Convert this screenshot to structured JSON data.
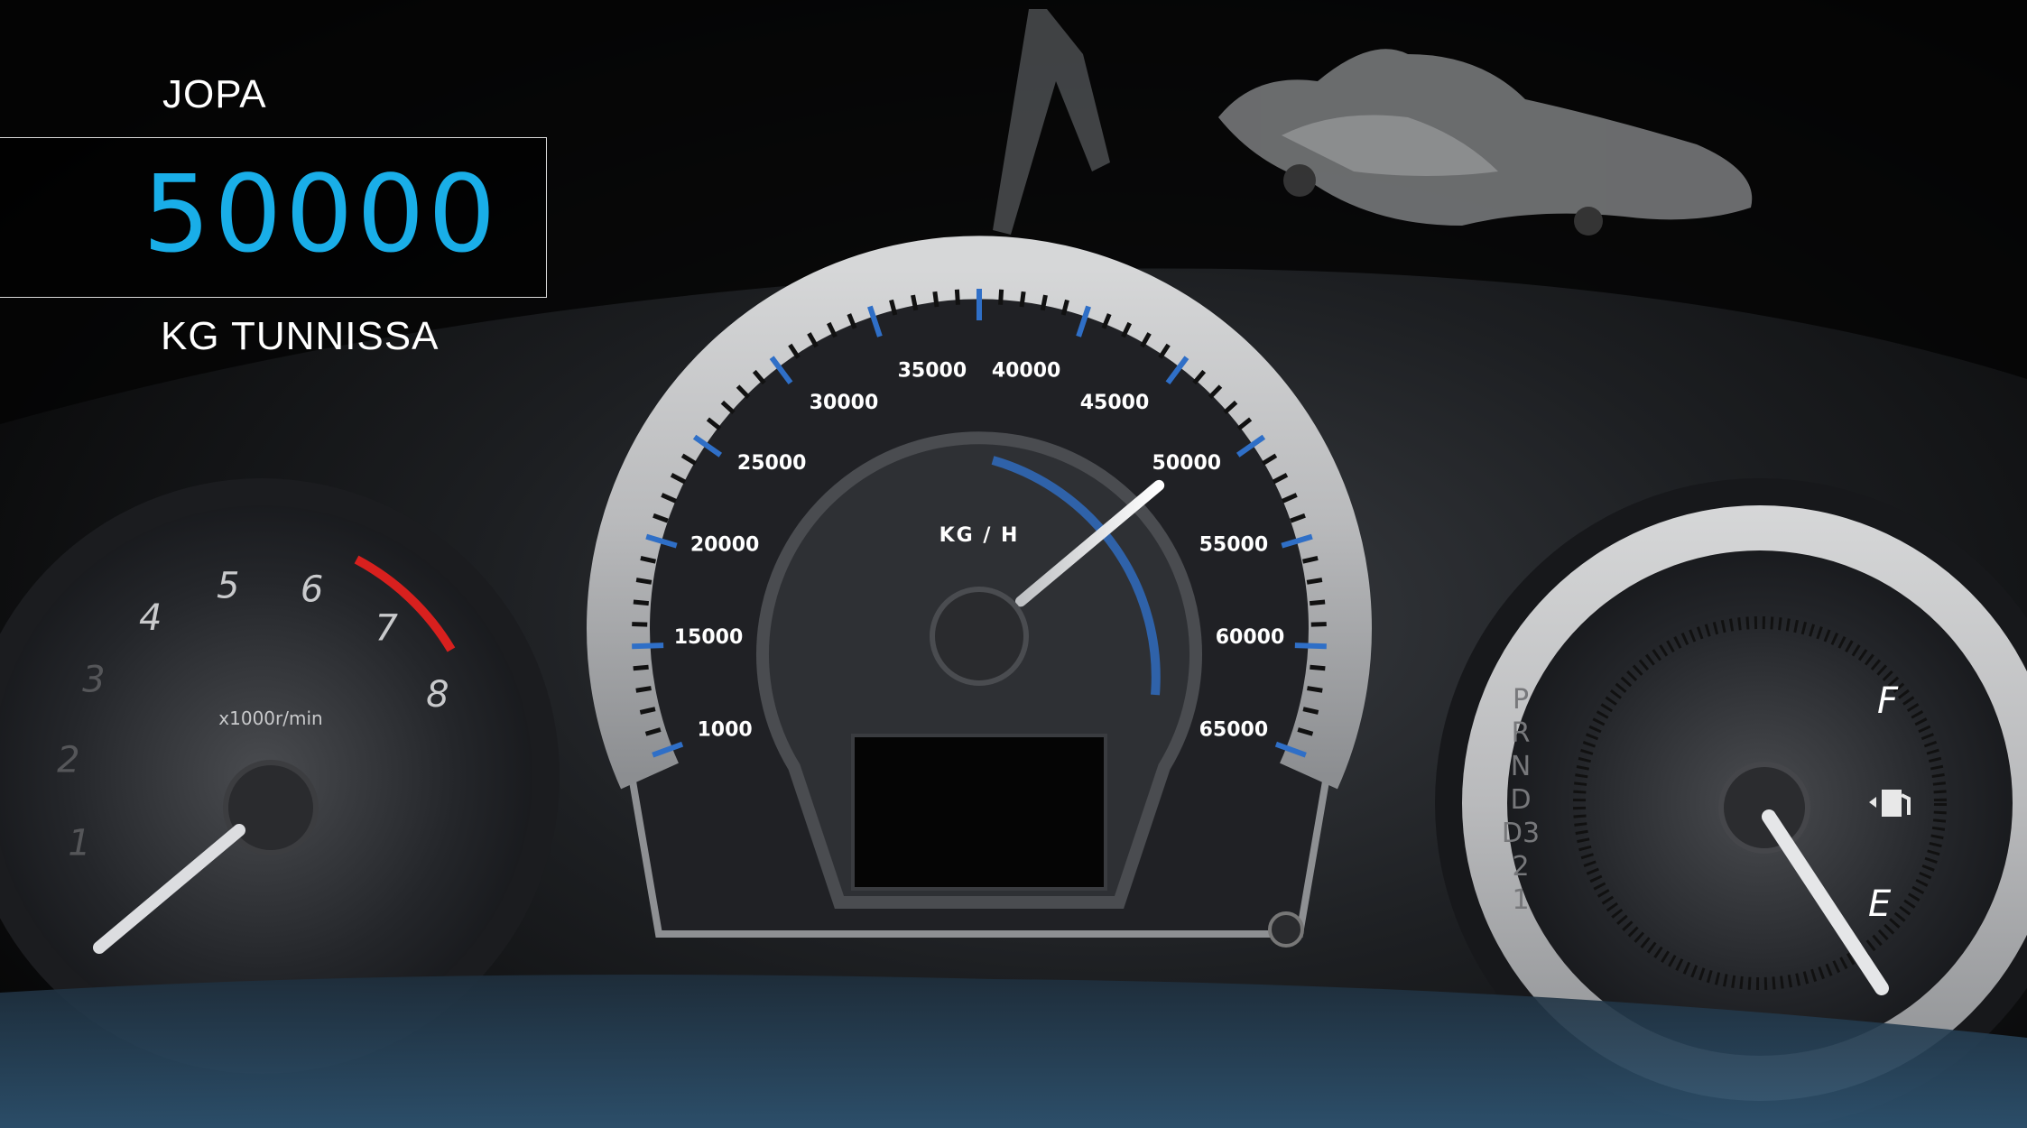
{
  "headline": {
    "top_label": "JOPA",
    "value": "50000",
    "bottom_label": "KG TUNNISSA"
  },
  "speedometer": {
    "unit_label": "KG / H",
    "tick_labels": [
      "1000",
      "15000",
      "20000",
      "25000",
      "30000",
      "35000",
      "40000",
      "45000",
      "50000",
      "55000",
      "60000",
      "65000"
    ],
    "needle_value": 50000,
    "accent_color": "#2f6fc7"
  },
  "tachometer": {
    "unit_label": "x1000r/min",
    "tick_labels": [
      "1",
      "2",
      "3",
      "4",
      "5",
      "6",
      "7",
      "8"
    ],
    "redline_color": "#d8201e"
  },
  "fuel_gauge": {
    "full_label": "F",
    "empty_label": "E",
    "gear_labels": [
      "P",
      "R",
      "N",
      "D",
      "D3",
      "2",
      "1"
    ],
    "icon": "fuel-pump-icon"
  },
  "colors": {
    "accent": "#19aee8",
    "background": "#000000"
  }
}
